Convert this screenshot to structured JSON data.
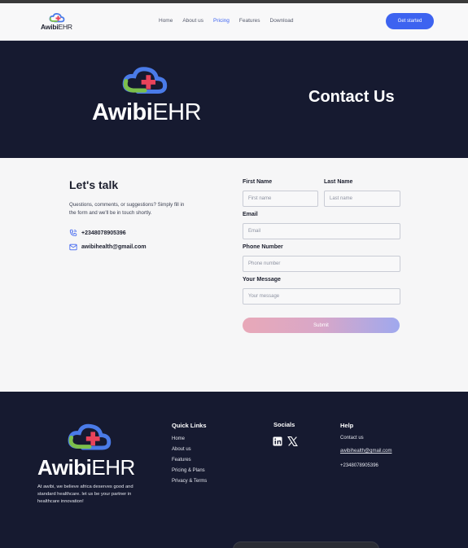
{
  "nav": {
    "brand_bold": "Awibi",
    "brand_thin": "EHR",
    "links": [
      "Home",
      "About us",
      "Pricing",
      "Features",
      "Download"
    ],
    "active_link": "Pricing",
    "cta": "Get started"
  },
  "hero": {
    "brand_bold": "Awibi",
    "brand_thin": "EHR",
    "title": "Contact Us"
  },
  "contact": {
    "title": "Let's talk",
    "description": "Questions, comments, or suggestions? Simply fill in the form and we'll be in touch shortly.",
    "phone": "+2348078905396",
    "email": "awibihealth@gmail.com"
  },
  "form": {
    "first_name_label": "First Name",
    "first_name_placeholder": "First name",
    "last_name_label": "Last Name",
    "last_name_placeholder": "Last name",
    "email_label": "Email",
    "email_placeholder": "Email",
    "phone_label": "Phone Number",
    "phone_placeholder": "Phone number",
    "message_label": "Your Message",
    "message_placeholder": "Your message",
    "submit": "Submit"
  },
  "footer": {
    "brand_bold": "Awibi",
    "brand_thin": "EHR",
    "tagline": "At awibi, we believe africa deserves good and standard healthcare. let us be your partner in healthcare innovation!",
    "quick_links_title": "Quick Links",
    "quick_links": [
      "Home",
      "About us",
      "Features",
      "Pricing & Plans",
      "Privacy & Terms"
    ],
    "socials_title": "Socials",
    "help_title": "Help",
    "help_items": [
      "Contact us",
      "awibihealth@gmail.com",
      "+2348078905396"
    ]
  },
  "icons": {
    "logo": "cloud-plus-logo-icon",
    "phone": "phone-icon",
    "mail": "mail-icon",
    "linkedin": "linkedin-icon",
    "x": "x-icon"
  },
  "colors": {
    "accent": "#3d63f0",
    "dark": "#161a30",
    "logo_blue": "#4a7be8",
    "logo_green": "#7cc04b",
    "logo_red": "#e8435a"
  }
}
